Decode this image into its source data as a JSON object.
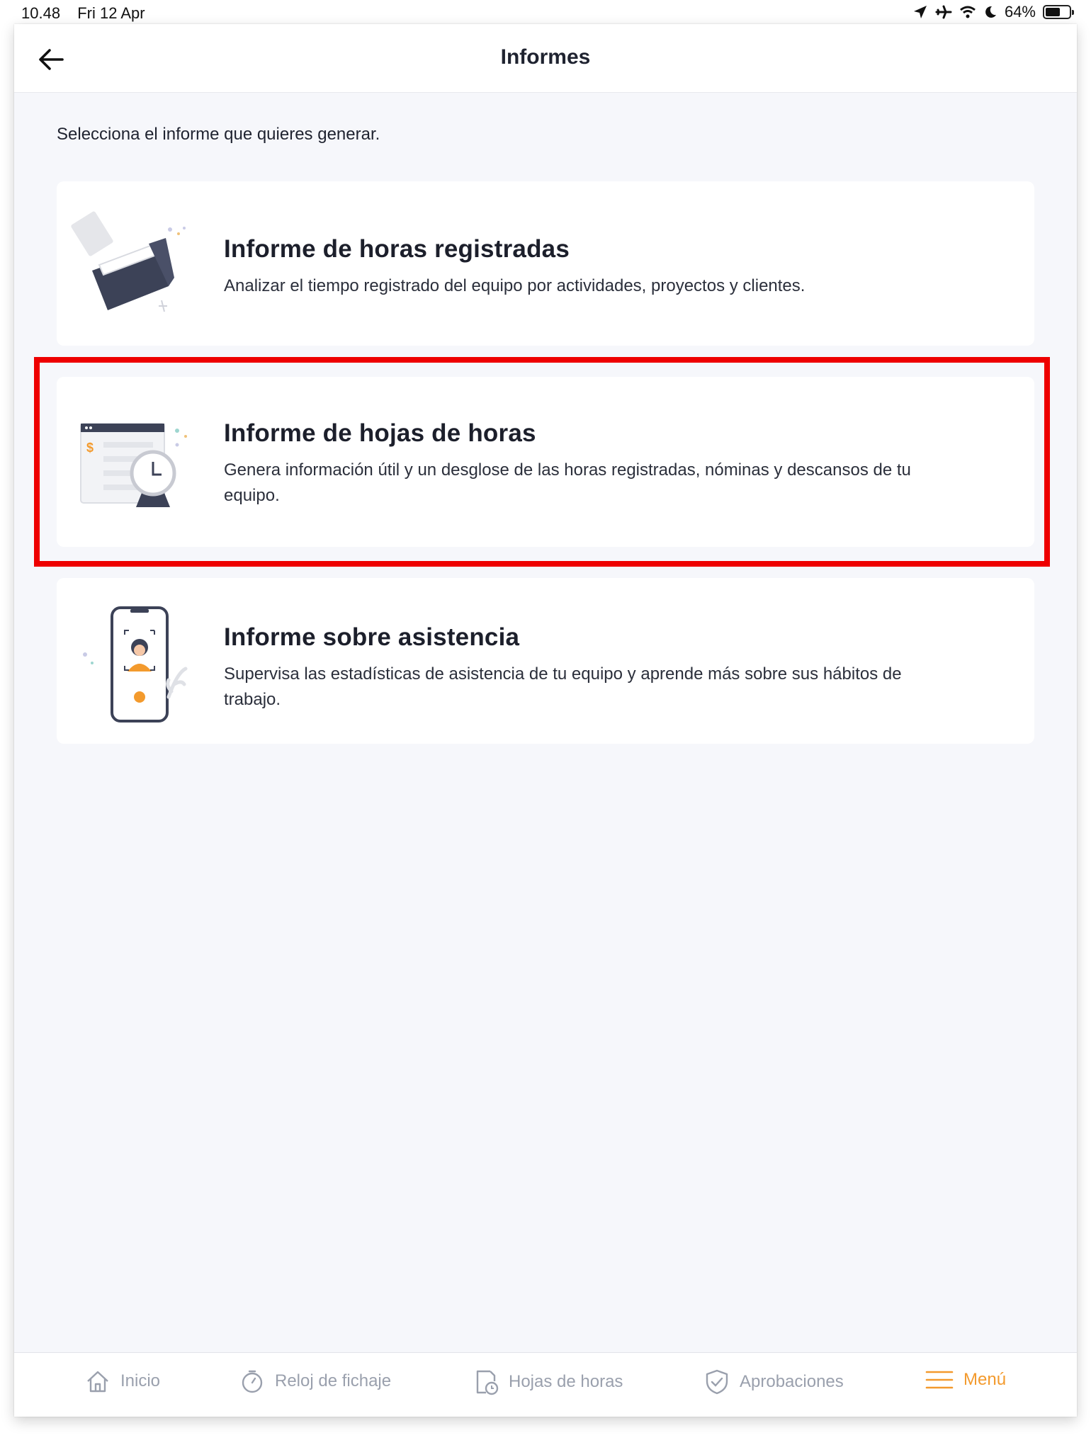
{
  "status_bar": {
    "time": "10.48",
    "date": "Fri 12 Apr",
    "battery": "64%",
    "battery_level": 0.64
  },
  "header": {
    "title": "Informes",
    "back_icon": "arrow-left-icon"
  },
  "intro": "Selecciona el informe que quieres generar.",
  "reports": [
    {
      "title": "Informe de horas registradas",
      "description": "Analizar el tiempo registrado del equipo por actividades, proyectos y clientes.",
      "icon": "folder-illustration"
    },
    {
      "title": "Informe de hojas de horas",
      "description": "Genera información útil y un desglose de las horas registradas, nóminas y descansos de tu equipo.",
      "icon": "timesheet-clock-illustration",
      "highlighted": true
    },
    {
      "title": "Informe sobre asistencia",
      "description": "Supervisa las estadísticas de asistencia de tu equipo y aprende más sobre sus hábitos de trabajo.",
      "icon": "phone-attendance-illustration"
    }
  ],
  "tab_bar": {
    "items": [
      {
        "label": "Inicio",
        "icon": "home-icon"
      },
      {
        "label": "Reloj de fichaje",
        "icon": "stopwatch-icon"
      },
      {
        "label": "Hojas de horas",
        "icon": "timesheet-icon"
      },
      {
        "label": "Aprobaciones",
        "icon": "shield-check-icon"
      },
      {
        "label": "Menú",
        "icon": "menu-icon",
        "active": true
      }
    ]
  },
  "colors": {
    "accent": "#f39a2d",
    "highlight": "#ee0000",
    "background": "#f6f7fb",
    "illustration_dark": "#3c4257"
  }
}
